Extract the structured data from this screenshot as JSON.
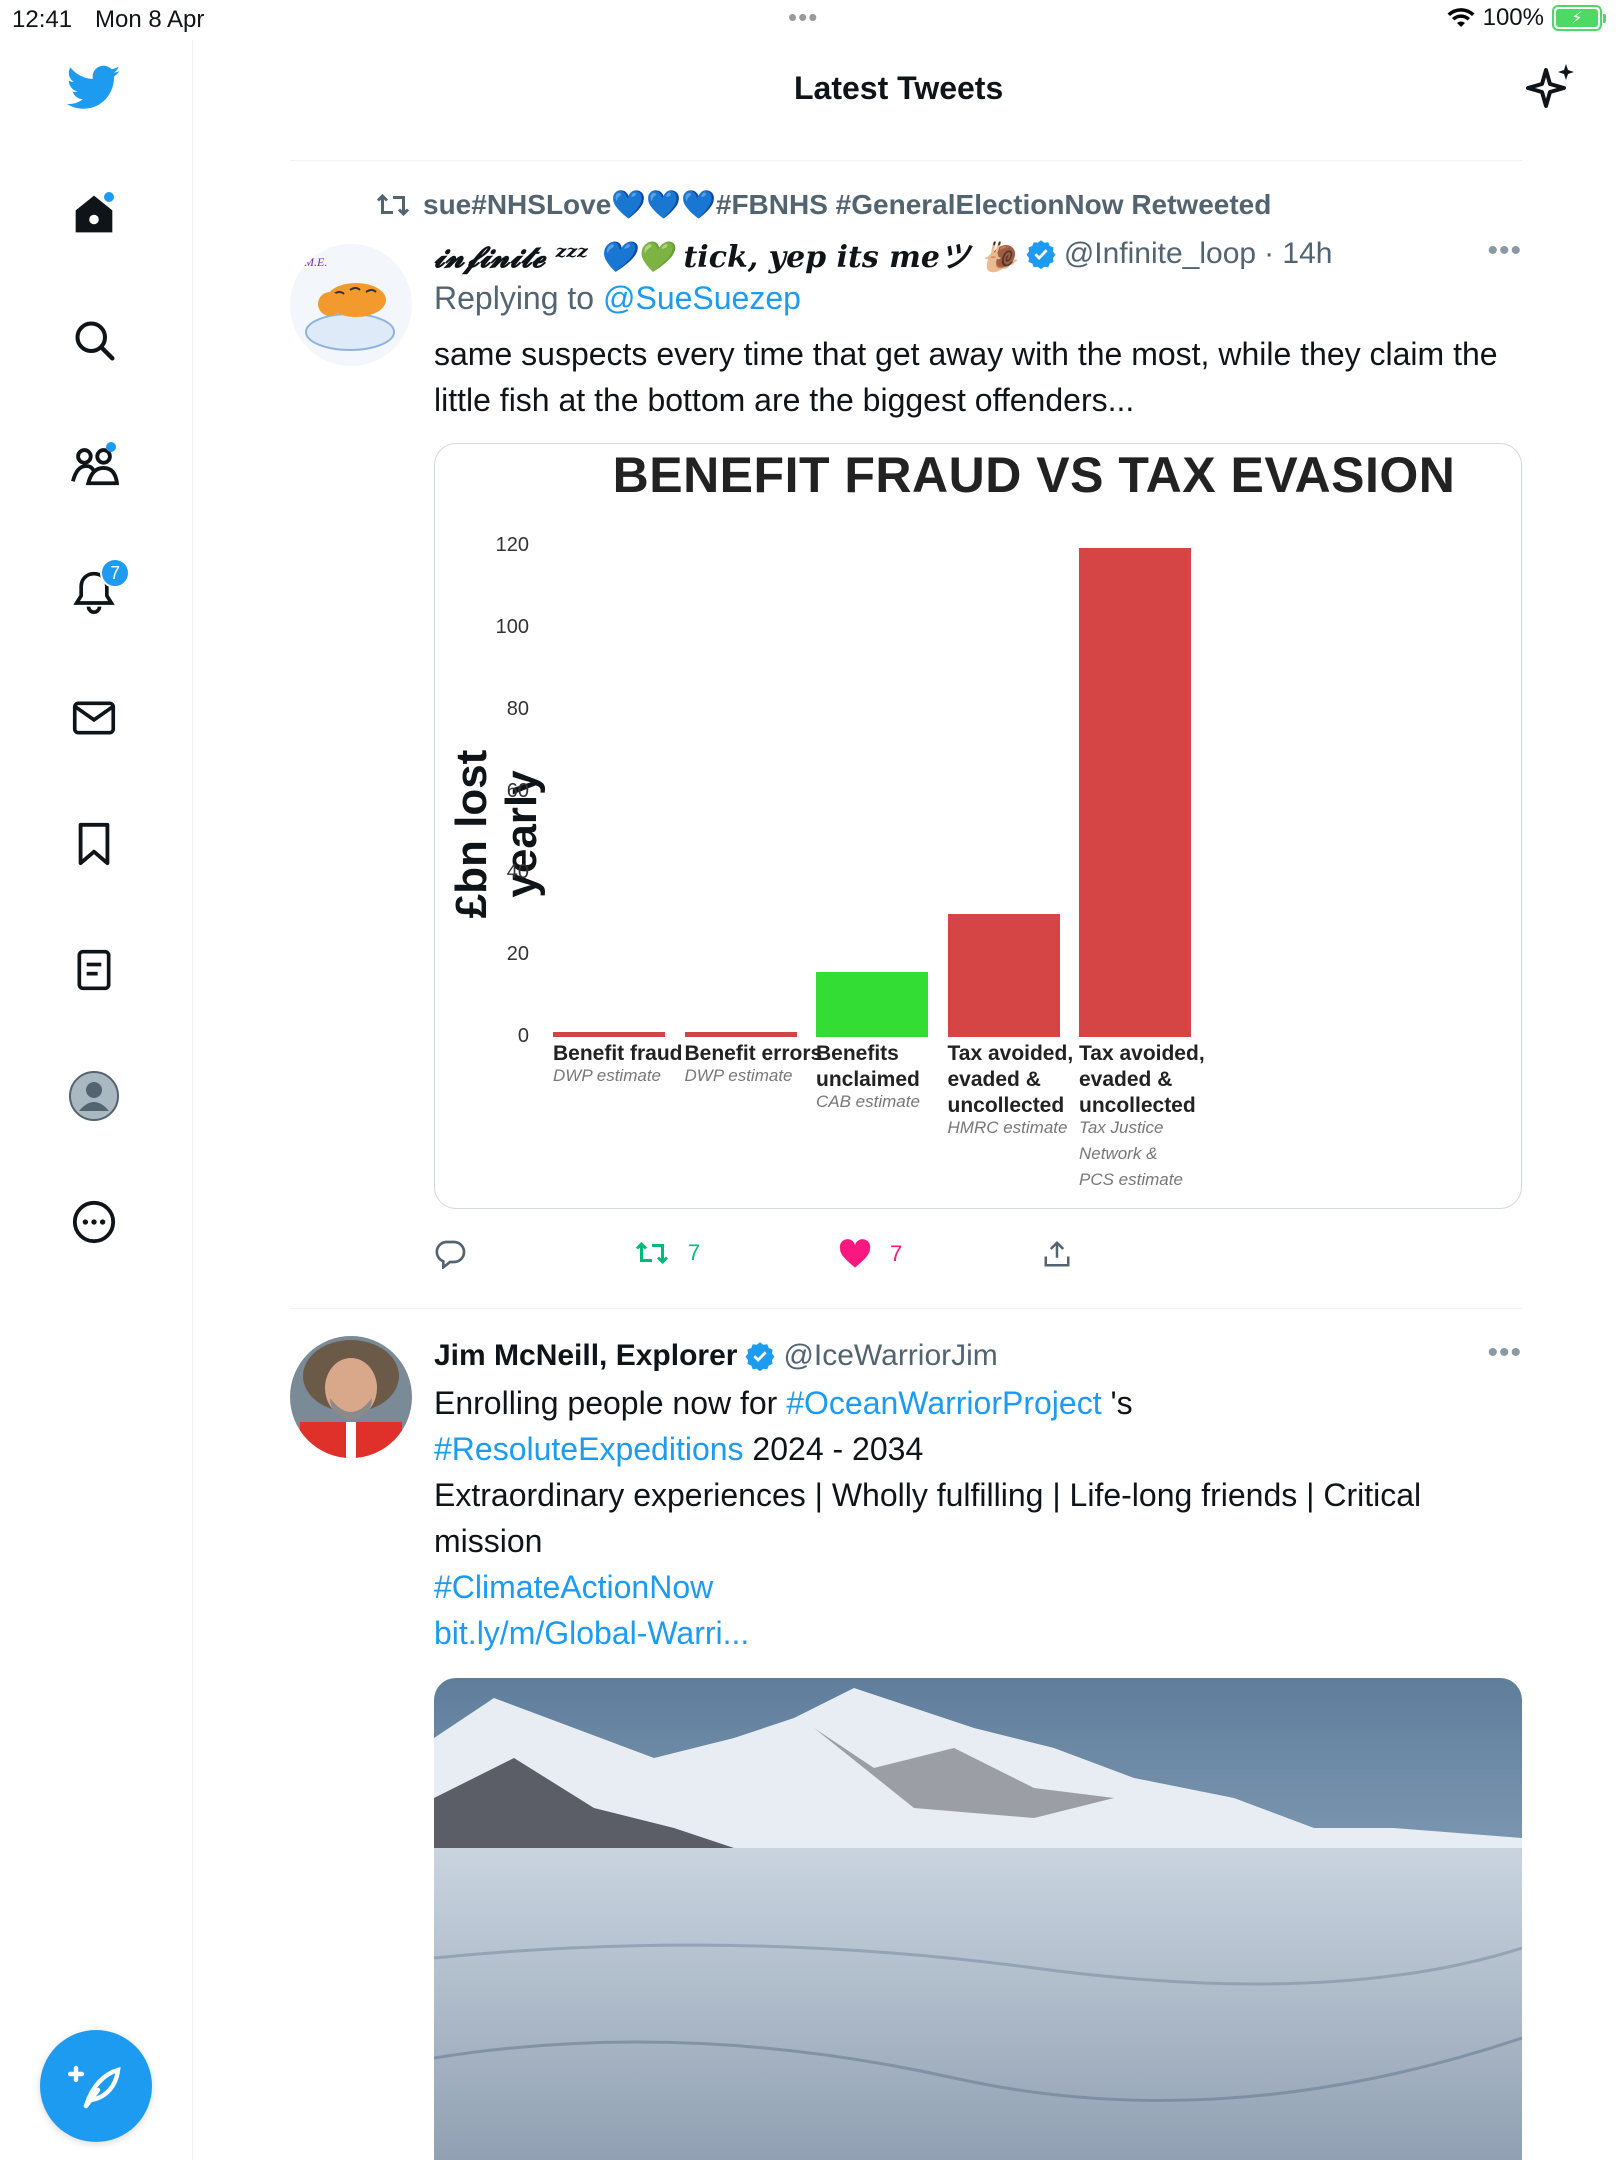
{
  "status_bar": {
    "time": "12:41",
    "date": "Mon 8 Apr",
    "dots": "•••",
    "battery": "100%"
  },
  "sidebar": {
    "notifications_badge": "7",
    "items": [
      "twitter-logo",
      "home",
      "search",
      "communities",
      "notifications",
      "messages",
      "bookmarks",
      "lists",
      "profile",
      "more"
    ]
  },
  "header": {
    "title": "Latest Tweets"
  },
  "tweet1": {
    "retweeted_by": "sue#NHSLove💙💙💙#FBNHS #GeneralElectionNow Retweeted",
    "name": "𝓲𝓷𝓯𝓲𝓷𝓲𝓽𝓮 ᶻᶻᶻ 💙💚 tick, yep its meツ 🐌",
    "handle": "@Infinite_loop",
    "time": "· 14h",
    "replying_prefix": "Replying to ",
    "replying_handle": "@SueSuezep",
    "text": "same suspects every time that get away with the most, while they claim the little fish at the bottom are the biggest offenders...",
    "retweets": "7",
    "likes": "7"
  },
  "chart_data": {
    "type": "bar",
    "title": "BENEFIT FRAUD VS TAX EVASION",
    "ylabel": "£bn lost yearly",
    "xlabel": "",
    "ylim": [
      0,
      120
    ],
    "yticks": [
      "120",
      "100",
      "80",
      "60",
      "40",
      "20",
      "0"
    ],
    "categories": [
      {
        "label": [
          "Benefit fraud"
        ],
        "source": [
          "DWP estimate"
        ],
        "value": 1.2,
        "color": "#cf4545"
      },
      {
        "label": [
          "Benefit errors"
        ],
        "source": [
          "DWP estimate"
        ],
        "value": 1.3,
        "color": "#cf4545"
      },
      {
        "label": [
          "Benefits",
          "unclaimed"
        ],
        "source": [
          "CAB estimate"
        ],
        "value": 16,
        "color": "#33dd33"
      },
      {
        "label": [
          "Tax avoided,",
          "evaded &",
          "uncollected"
        ],
        "source": [
          "HMRC estimate"
        ],
        "value": 30,
        "color": "#d64545"
      },
      {
        "label": [
          "Tax avoided,",
          "evaded &",
          "uncollected"
        ],
        "source": [
          "Tax Justice",
          "Network &",
          "PCS estimate"
        ],
        "value": 119.5,
        "color": "#d64545"
      }
    ]
  },
  "tweet2": {
    "name": "Jim McNeill, Explorer",
    "handle": "@IceWarriorJim",
    "line1_link": "#OceanWarriorProject",
    "line1_prefix": "Enrolling people now for ",
    "line1_suffix": " 's",
    "line2_link": "#ResoluteExpeditions",
    "line2_suffix": " 2024 - 2034",
    "line3": "Extraordinary experiences | Wholly fulfilling | Life-long friends | Critical mission",
    "line4_link": "#ClimateActionNow",
    "line5_link": "bit.ly/m/Global-Warri..."
  },
  "colors": {
    "accent": "#1d9bf0",
    "retweet": "#00ba7c",
    "like": "#f91880"
  }
}
